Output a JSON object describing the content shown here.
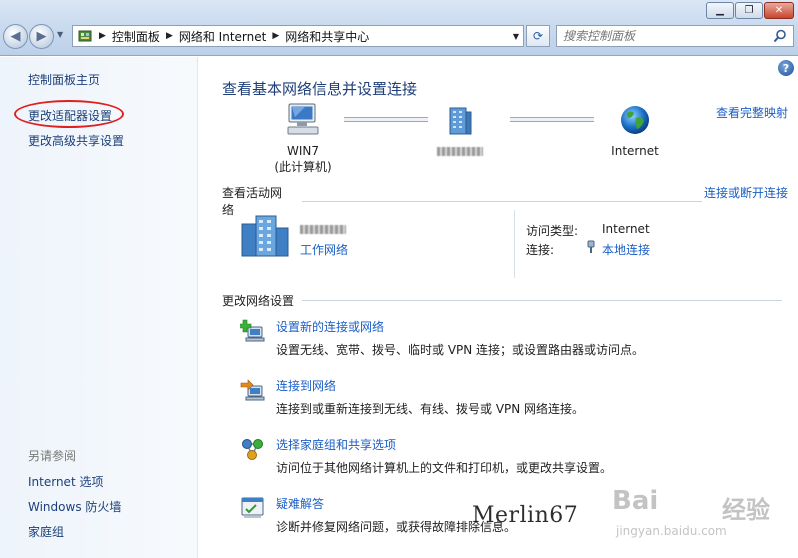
{
  "window": {
    "minimize": "▁",
    "maximize": "❐",
    "close": "✕"
  },
  "address": {
    "crumbs": [
      "控制面板",
      "网络和 Internet",
      "网络和共享中心"
    ]
  },
  "search": {
    "placeholder": "搜索控制面板"
  },
  "sidebar": {
    "home": "控制面板主页",
    "adapter": "更改适配器设置",
    "sharing": "更改高级共享设置",
    "see_also": "另请参阅",
    "links": [
      "Internet 选项",
      "Windows 防火墙",
      "家庭组"
    ]
  },
  "main": {
    "title": "查看基本网络信息并设置连接",
    "map_link": "查看完整映射",
    "nodes": {
      "pc_name": "WIN7",
      "pc_sub": "(此计算机)",
      "internet": "Internet"
    },
    "active": {
      "heading": "查看活动网络",
      "connect_link": "连接或断开连接",
      "network_type": "工作网络",
      "access_label": "访问类型:",
      "access_value": "Internet",
      "conn_label": "连接:",
      "conn_value": "本地连接"
    },
    "change": {
      "heading": "更改网络设置",
      "tasks": [
        {
          "title": "设置新的连接或网络",
          "desc": "设置无线、宽带、拨号、临时或 VPN 连接；或设置路由器或访问点。",
          "icon": "new-connection-icon"
        },
        {
          "title": "连接到网络",
          "desc": "连接到或重新连接到无线、有线、拨号或 VPN 网络连接。",
          "icon": "connect-network-icon"
        },
        {
          "title": "选择家庭组和共享选项",
          "desc": "访问位于其他网络计算机上的文件和打印机，或更改共享设置。",
          "icon": "homegroup-icon"
        },
        {
          "title": "疑难解答",
          "desc": "诊断并修复网络问题，或获得故障排除信息。",
          "icon": "troubleshoot-icon"
        }
      ]
    }
  },
  "watermark": {
    "author": "Merlin67",
    "brand": "Bai",
    "brand_cn": "经验",
    "site": "jingyan.baidu.com"
  },
  "colors": {
    "link": "#1a5ec5",
    "title": "#1f3e7a",
    "highlight": "#e02020"
  }
}
